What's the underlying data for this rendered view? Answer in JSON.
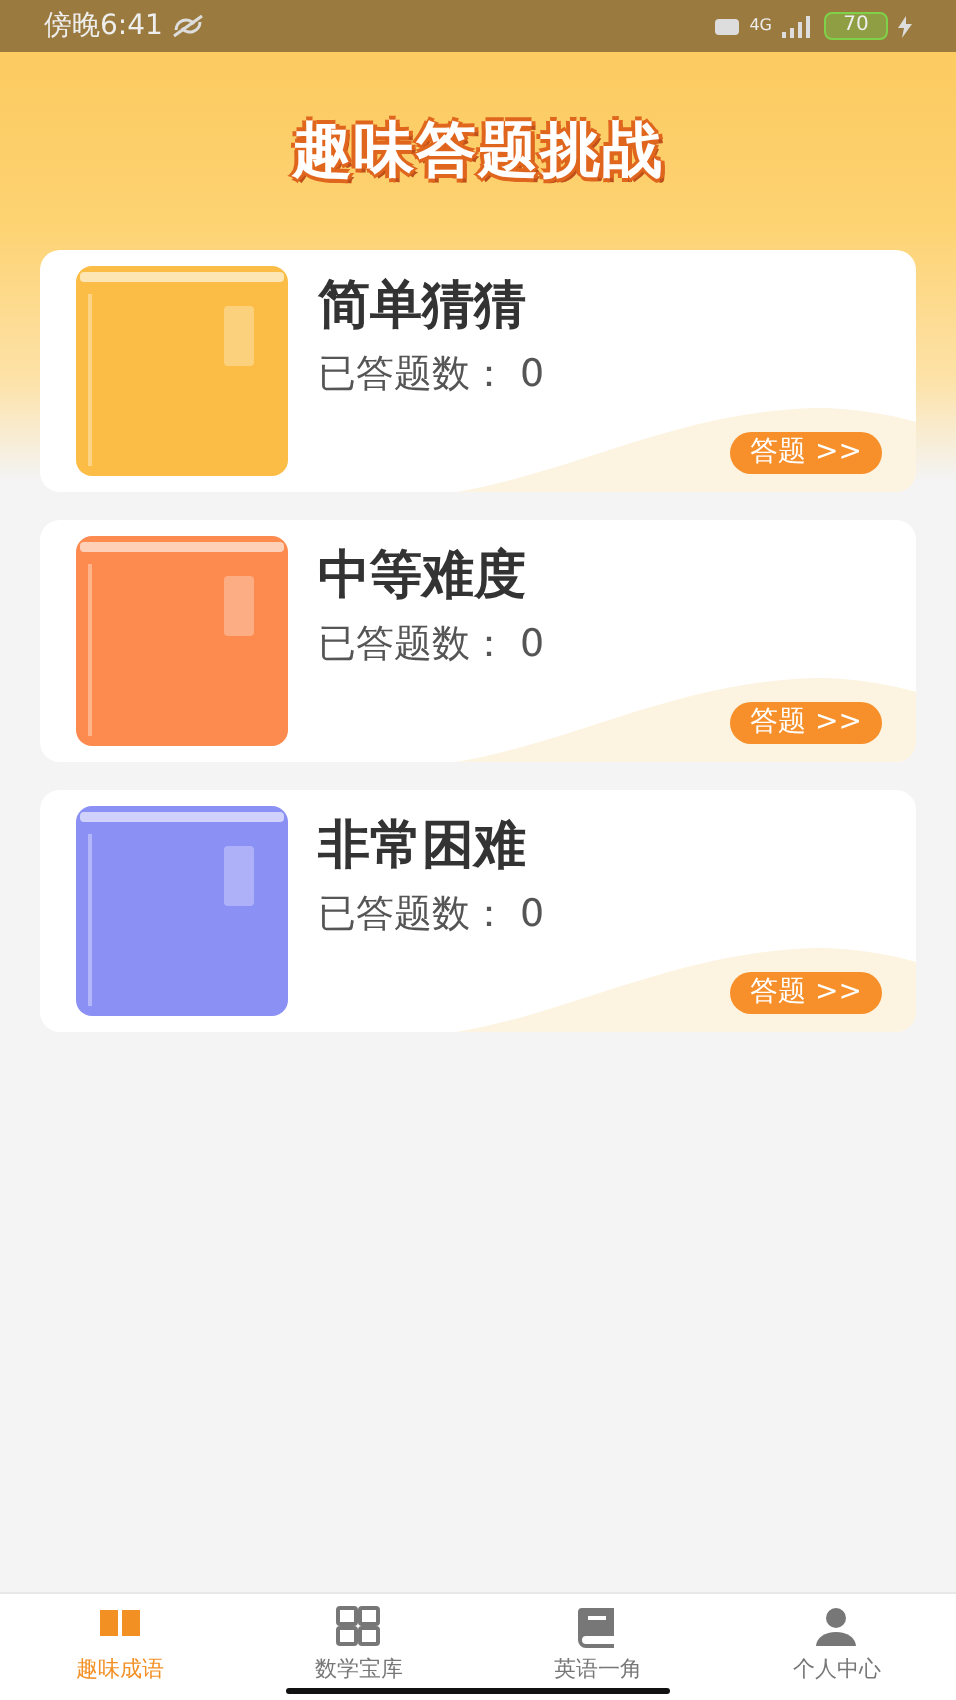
{
  "status_bar": {
    "time": "傍晚6:41",
    "network": "4G",
    "battery": "70"
  },
  "title": "趣味答题挑战",
  "levels": [
    {
      "title": "简单猜猜",
      "count_label": "已答题数：",
      "count": "0",
      "color": "#fbbd45",
      "button": "答题 >>"
    },
    {
      "title": "中等难度",
      "count_label": "已答题数：",
      "count": "0",
      "color": "#fd8a4e",
      "button": "答题 >>"
    },
    {
      "title": "非常困难",
      "count_label": "已答题数：",
      "count": "0",
      "color": "#8b90f5",
      "button": "答题 >>"
    }
  ],
  "tabs": [
    {
      "label": "趣味成语",
      "kind": "book",
      "selected": true
    },
    {
      "label": "数学宝库",
      "kind": "calc",
      "selected": false
    },
    {
      "label": "英语一角",
      "kind": "notebook",
      "selected": false
    },
    {
      "label": "个人中心",
      "kind": "person",
      "selected": false
    }
  ]
}
